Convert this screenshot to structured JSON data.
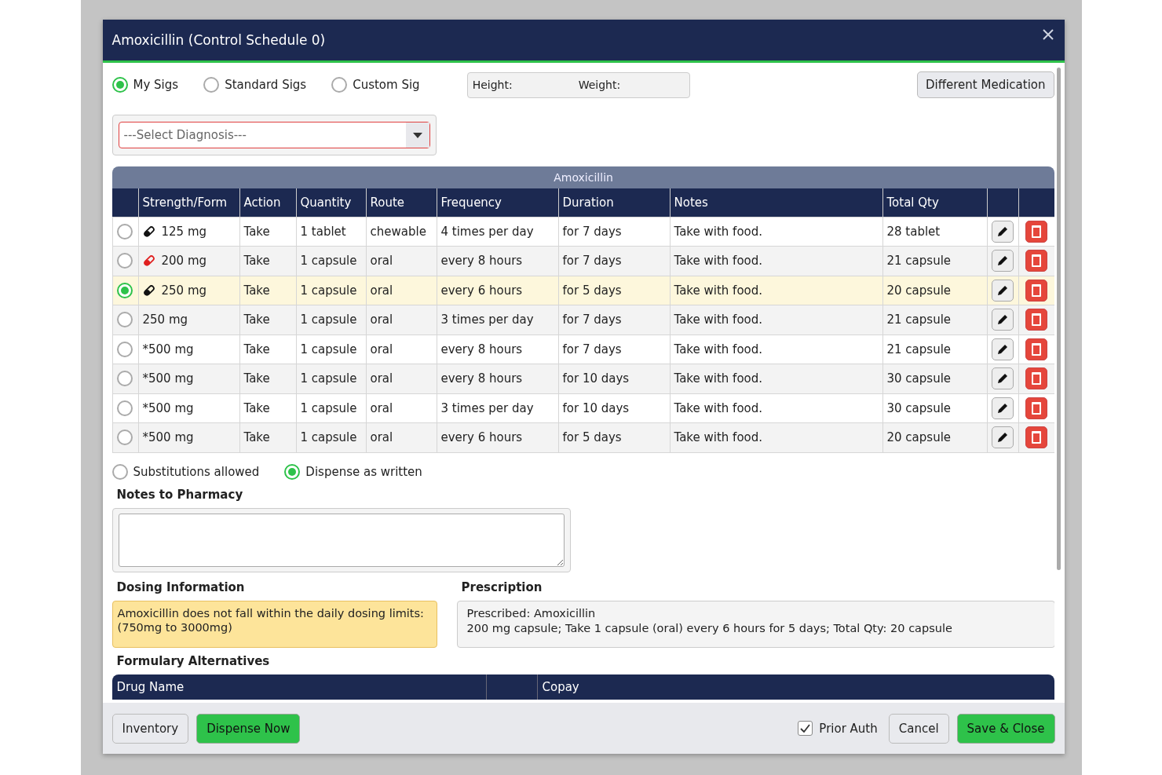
{
  "window": {
    "title": "Amoxicillin (Control Schedule 0)"
  },
  "sig_options": [
    {
      "label": "My Sigs",
      "selected": true
    },
    {
      "label": "Standard Sigs",
      "selected": false
    },
    {
      "label": "Custom Sig",
      "selected": false
    }
  ],
  "vitals": {
    "height_label": "Height:",
    "weight_label": "Weight:"
  },
  "different_medication_button": "Different Medication",
  "diagnosis": {
    "placeholder": "---Select Diagnosis---"
  },
  "sig_table": {
    "title": "Amoxicillin",
    "columns": [
      "Strength/Form",
      "Action",
      "Quantity",
      "Route",
      "Frequency",
      "Duration",
      "Notes",
      "Total Qty"
    ],
    "rows": [
      {
        "selected": false,
        "color": "#111111",
        "strength": "125 mg",
        "action": "Take",
        "quantity": "1 tablet",
        "route": "chewable",
        "frequency": "4 times per day",
        "duration": "for 7 days",
        "notes": "Take with food.",
        "total_qty": "28 tablet"
      },
      {
        "selected": false,
        "color": "#e02020",
        "strength": "200 mg",
        "action": "Take",
        "quantity": "1 capsule",
        "route": "oral",
        "frequency": "every 8 hours",
        "duration": "for 7 days",
        "notes": "Take with food.",
        "total_qty": "21 capsule"
      },
      {
        "selected": true,
        "color": "#111111",
        "strength": "250 mg",
        "action": "Take",
        "quantity": "1 capsule",
        "route": "oral",
        "frequency": "every 6 hours",
        "duration": "for 5 days",
        "notes": "Take with food.",
        "total_qty": "20 capsule"
      },
      {
        "selected": false,
        "strength": "250 mg",
        "action": "Take",
        "quantity": "1 capsule",
        "route": "oral",
        "frequency": "3 times per day",
        "duration": "for 7 days",
        "notes": "Take with food.",
        "total_qty": "21 capsule"
      },
      {
        "selected": false,
        "strength": "*500 mg",
        "action": "Take",
        "quantity": "1 capsule",
        "route": "oral",
        "frequency": "every 8 hours",
        "duration": "for 7 days",
        "notes": "Take with food.",
        "total_qty": "21 capsule"
      },
      {
        "selected": false,
        "strength": "*500 mg",
        "action": "Take",
        "quantity": "1 capsule",
        "route": "oral",
        "frequency": "every 8 hours",
        "duration": "for 10 days",
        "notes": "Take with food.",
        "total_qty": "30 capsule"
      },
      {
        "selected": false,
        "strength": "*500 mg",
        "action": "Take",
        "quantity": "1 capsule",
        "route": "oral",
        "frequency": "3 times per day",
        "duration": "for 10 days",
        "notes": "Take with food.",
        "total_qty": "30 capsule"
      },
      {
        "selected": false,
        "strength": "*500 mg",
        "action": "Take",
        "quantity": "1 capsule",
        "route": "oral",
        "frequency": "every 6 hours",
        "duration": "for 5 days",
        "notes": "Take with food.",
        "total_qty": "20 capsule"
      }
    ]
  },
  "substitution_options": [
    {
      "label": "Substitutions allowed",
      "selected": false
    },
    {
      "label": "Dispense as written",
      "selected": true
    }
  ],
  "notes_to_pharmacy": {
    "label": "Notes to Pharmacy"
  },
  "dosing_information": {
    "label": "Dosing Information",
    "message": "Amoxicillin does not fall within the daily dosing limits: (750mg to 3000mg)"
  },
  "prescription": {
    "label": "Prescription",
    "line_1": "Prescribed: Amoxicillin",
    "line_2": "200 mg capsule; Take 1 capsule (oral) every 6 hours for 5 days; Total Qty: 20 capsule"
  },
  "formulary_alternatives": {
    "label": "Formulary Alternatives",
    "columns": [
      "Drug Name",
      "Copay"
    ]
  },
  "footer": {
    "inventory_button": "Inventory",
    "dispense_button": "Dispense Now",
    "prior_auth": {
      "label": "Prior Auth",
      "checked": true
    },
    "cancel_button": "Cancel",
    "save_button": "Save & Close"
  }
}
